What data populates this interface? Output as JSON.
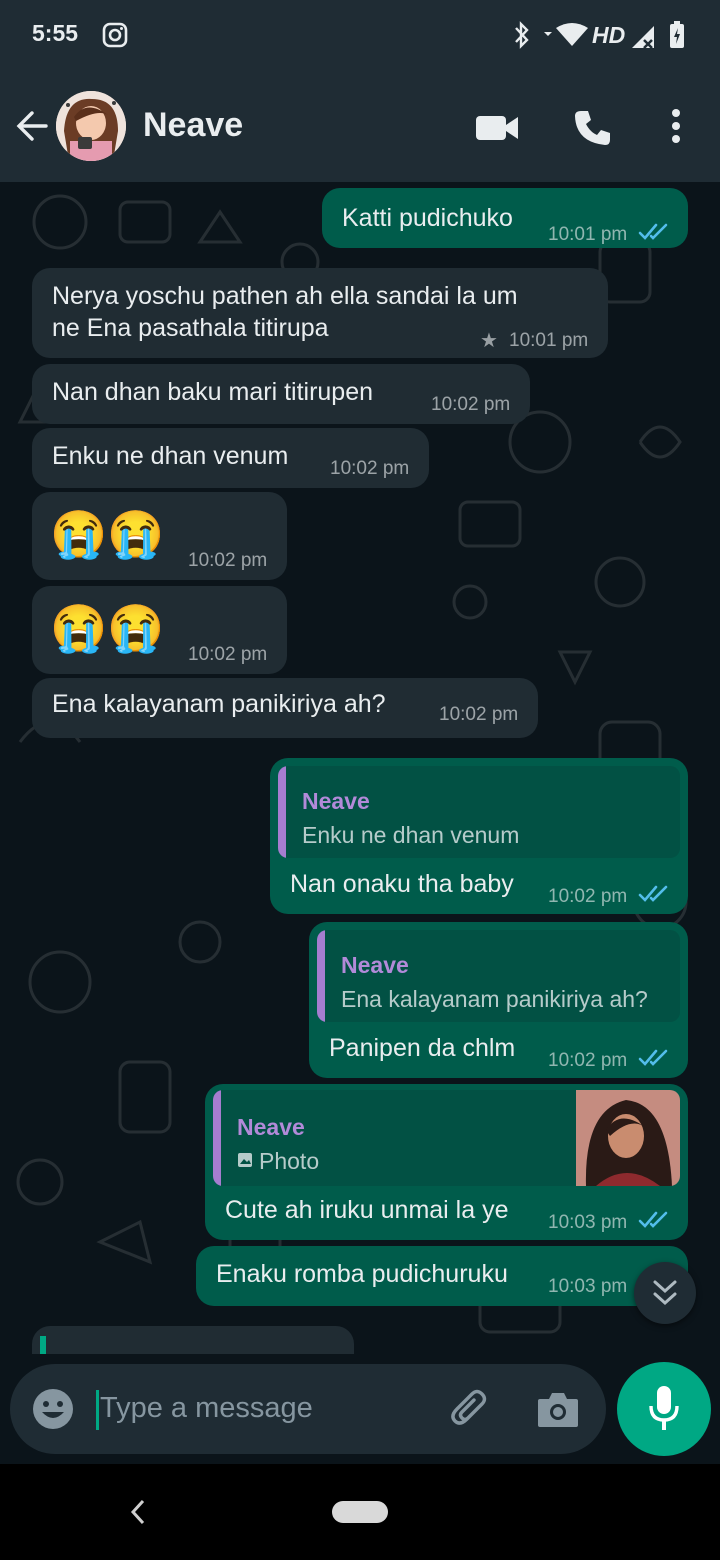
{
  "status_bar": {
    "time": "5:55",
    "network_label": "HD",
    "icons": [
      "instagram-icon",
      "bluetooth-icon",
      "wifi-icon",
      "signal-icon",
      "battery-charging-icon"
    ]
  },
  "header": {
    "contact_name": "Neave",
    "icons": [
      "back-arrow-icon",
      "video-call-icon",
      "voice-call-icon",
      "more-options-icon"
    ]
  },
  "messages": [
    {
      "direction": "out",
      "text": "Katti pudichuko",
      "time": "10:01 pm",
      "read": true
    },
    {
      "direction": "in",
      "text_lines": [
        "Nerya yoschu pathen ah ella sandai la um",
        "ne Ena pasathala titirupa"
      ],
      "time": "10:01 pm",
      "starred": true
    },
    {
      "direction": "in",
      "text": "Nan dhan baku mari titirupen",
      "time": "10:02 pm"
    },
    {
      "direction": "in",
      "text": "Enku ne dhan venum",
      "time": "10:02 pm"
    },
    {
      "direction": "in",
      "emoji": "😭😭",
      "time": "10:02 pm"
    },
    {
      "direction": "in",
      "emoji": "😭😭",
      "time": "10:02 pm"
    },
    {
      "direction": "in",
      "text": "Ena kalayanam panikiriya ah?",
      "time": "10:02 pm"
    },
    {
      "direction": "out",
      "reply_to": {
        "sender": "Neave",
        "text": "Enku ne dhan venum"
      },
      "text": "Nan onaku tha baby",
      "time": "10:02 pm",
      "read": true
    },
    {
      "direction": "out",
      "reply_to": {
        "sender": "Neave",
        "text": "Ena kalayanam panikiriya ah?"
      },
      "text": "Panipen da chlm",
      "time": "10:02 pm",
      "read": true
    },
    {
      "direction": "out",
      "reply_to": {
        "sender": "Neave",
        "text": "Photo",
        "has_photo": true
      },
      "text": "Cute ah iruku unmai la ye",
      "time": "10:03 pm",
      "read": true
    },
    {
      "direction": "out",
      "text": "Enaku romba pudichuruku",
      "time": "10:03 pm"
    }
  ],
  "input": {
    "placeholder": "Type a message",
    "icons": [
      "emoji-icon",
      "attach-icon",
      "camera-icon",
      "microphone-icon"
    ]
  },
  "colors": {
    "background": "#0b141a",
    "header": "#1f2c34",
    "incoming_bubble": "#202c33",
    "outgoing_bubble": "#005c4b",
    "accent": "#00a884",
    "read_tick": "#53bdeb",
    "reply_sender": "#b28ad9"
  }
}
